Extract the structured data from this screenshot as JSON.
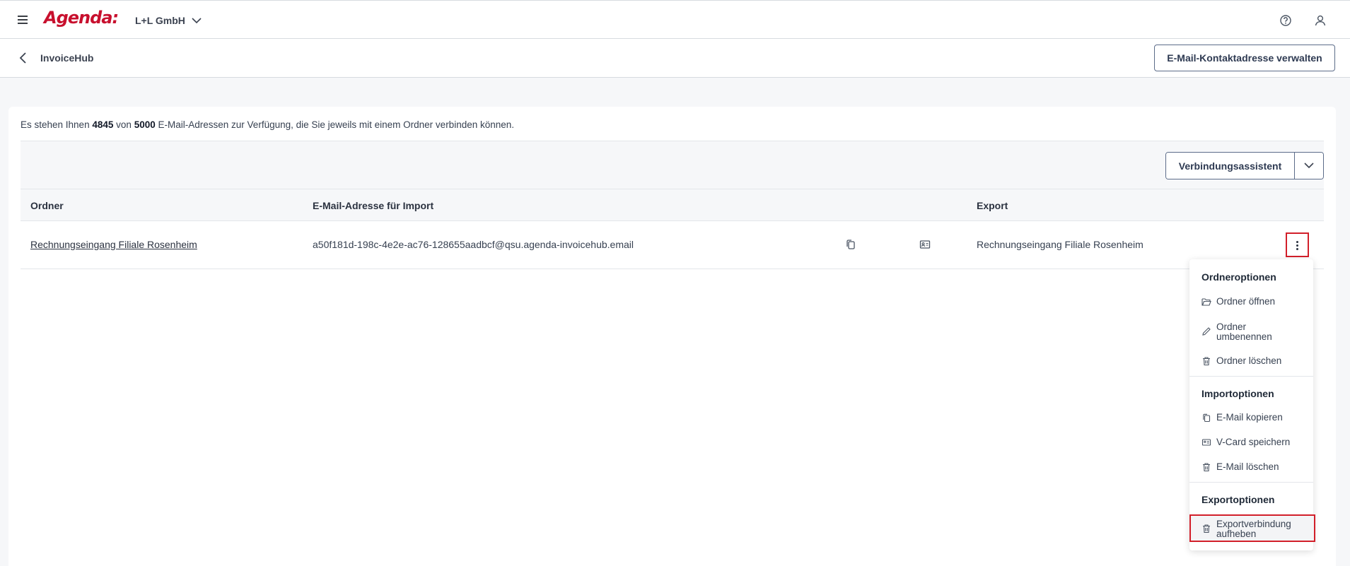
{
  "header": {
    "logo": "Agenda:",
    "company": "L+L GmbH",
    "brand_color": "#c8102e"
  },
  "subheader": {
    "title": "InvoiceHub",
    "manage_contact_label": "E-Mail-Kontaktadresse verwalten"
  },
  "info": {
    "prefix": "Es stehen Ihnen",
    "available": "4845",
    "middle": "von",
    "total": "5000",
    "suffix": "E-Mail-Adressen zur Verfügung, die Sie jeweils mit einem Ordner verbinden können."
  },
  "toolbar": {
    "assistant_label": "Verbindungsassistent"
  },
  "table": {
    "columns": [
      "Ordner",
      "E-Mail-Adresse für Import",
      "Export"
    ],
    "rows": [
      {
        "folder": "Rechnungseingang Filiale Rosenheim",
        "email": "a50f181d-198c-4e2e-ac76-128655aadbcf@qsu.agenda-invoicehub.email",
        "export": "Rechnungseingang Filiale Rosenheim"
      }
    ]
  },
  "menu": {
    "folder_options": "Ordneroptionen",
    "open_folder": "Ordner öffnen",
    "rename_folder": "Ordner umbenennen",
    "delete_folder": "Ordner löschen",
    "import_options": "Importoptionen",
    "copy_email": "E-Mail kopieren",
    "save_vcard": "V-Card speichern",
    "delete_email": "E-Mail löschen",
    "export_options": "Exportoptionen",
    "remove_export": "Exportverbindung aufheben"
  },
  "icons": [
    "menu-icon",
    "help-icon",
    "user-icon",
    "chevron-down-icon",
    "chevron-left-icon",
    "copy-icon",
    "vcard-icon",
    "more-vertical-icon",
    "folder-open-icon",
    "pencil-icon",
    "trash-icon"
  ]
}
